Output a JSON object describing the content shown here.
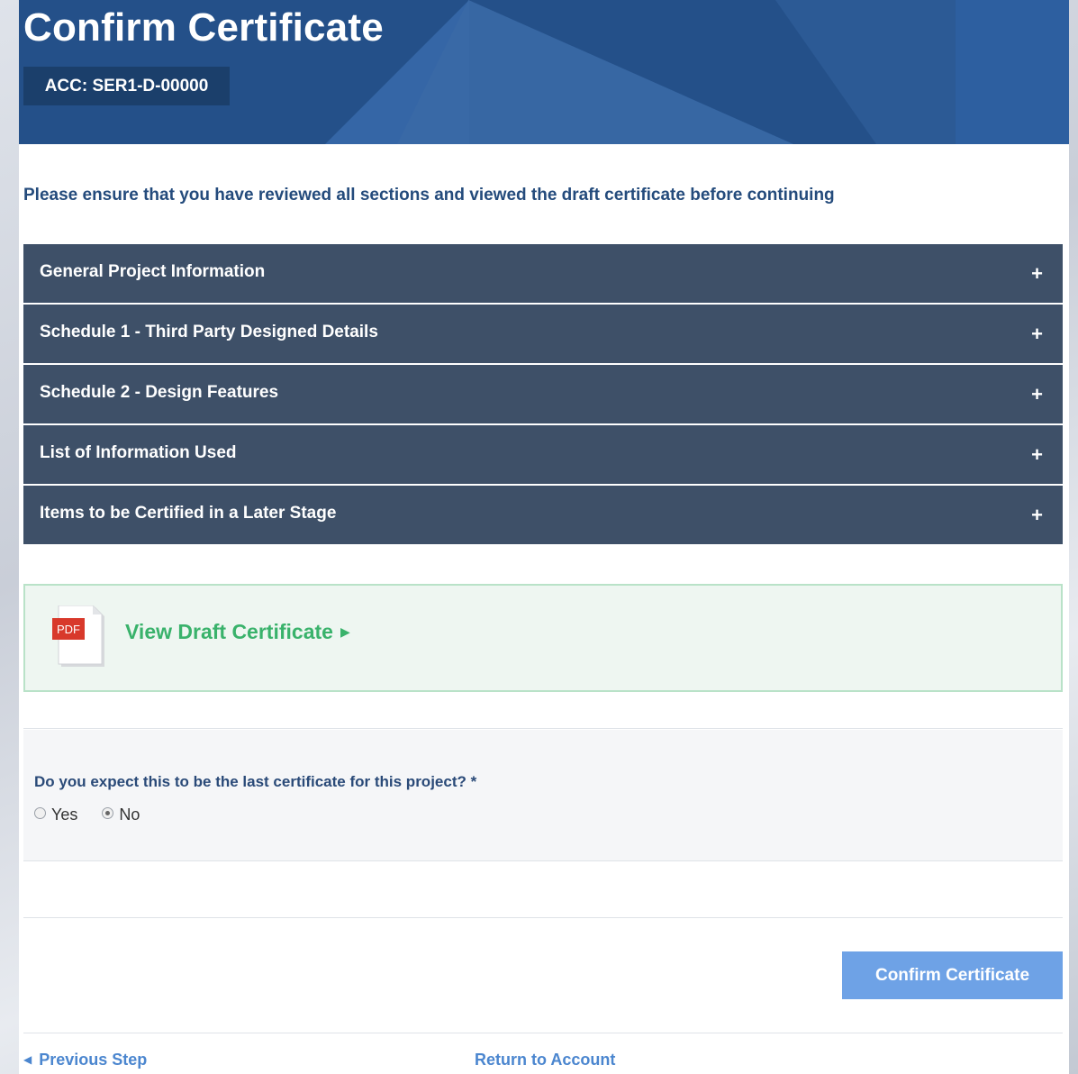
{
  "header": {
    "title": "Confirm Certificate",
    "account_badge": "ACC: SER1-D-00000"
  },
  "notice": "Please ensure that you have reviewed all sections and viewed the draft certificate before continuing",
  "sections": [
    {
      "label": "General Project Information",
      "toggle": "+"
    },
    {
      "label": "Schedule 1 - Third Party Designed Details",
      "toggle": "+"
    },
    {
      "label": "Schedule 2 - Design Features",
      "toggle": "+"
    },
    {
      "label": "List of Information Used",
      "toggle": "+"
    },
    {
      "label": "Items to be Certified in a Later Stage",
      "toggle": "+"
    }
  ],
  "draft": {
    "icon_label": "PDF",
    "link_label": "View Draft Certificate",
    "arrow": "▶"
  },
  "question": {
    "label": "Do you expect this to be the last certificate for this project? *",
    "options": [
      "Yes",
      "No"
    ],
    "selected": "No"
  },
  "actions": {
    "confirm_label": "Confirm Certificate",
    "previous_label": "Previous Step",
    "previous_arrow": "◀",
    "return_label": "Return to Account"
  },
  "colors": {
    "banner": "#245089",
    "section_bg": "#3e5068",
    "accent_green": "#39b26b",
    "button": "#6ea2e6",
    "link": "#4b86cf"
  }
}
